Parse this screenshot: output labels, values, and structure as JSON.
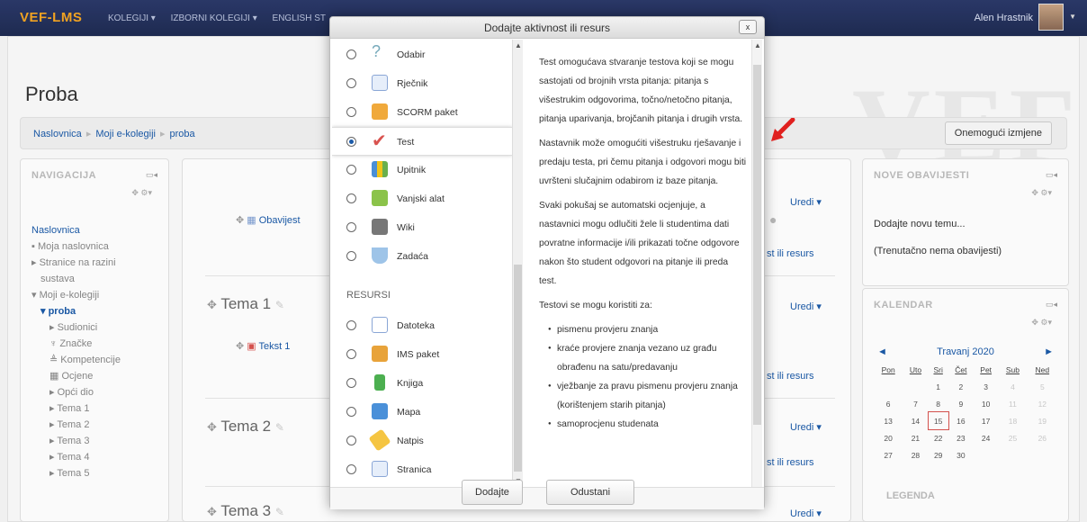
{
  "topbar": {
    "brand": "VEF-LMS",
    "menu": [
      "KOLEGIJI ▾",
      "IZBORNI KOLEGIJI ▾",
      "ENGLISH ST"
    ],
    "user_name": "Alen Hrastnik"
  },
  "page": {
    "title": "Proba",
    "breadcrumb": [
      "Naslovnica",
      "Moji e-kolegiji",
      "proba"
    ],
    "edit_button": "Onemogući izmjene"
  },
  "navigation": {
    "title": "NAVIGACIJA",
    "items": [
      "Naslovnica",
      "Moja naslovnica",
      "Stranice na razini",
      "sustava",
      "Moji e-kolegiji",
      "proba",
      "Sudionici",
      "Značke",
      "Kompetencije",
      "Ocjene",
      "Opći dio",
      "Tema 1",
      "Tema 2",
      "Tema 3",
      "Tema 4",
      "Tema 5"
    ]
  },
  "center": {
    "edit_label": "Uredi ▾",
    "add_label": "st ili resurs",
    "news_item": "Obavijest",
    "text_item": "Tekst 1",
    "topics": [
      "Tema 1",
      "Tema 2",
      "Tema 3"
    ]
  },
  "announcements": {
    "title": "NOVE OBAVIJESTI",
    "add_link": "Dodajte novu temu...",
    "empty": "(Trenutačno nema obavijesti)"
  },
  "calendar": {
    "title": "KALENDAR",
    "month": "Travanj 2020",
    "days": [
      "Pon",
      "Uto",
      "Sri",
      "Čet",
      "Pet",
      "Sub",
      "Ned"
    ],
    "weeks": [
      [
        "",
        "",
        "1",
        "2",
        "3",
        "4",
        "5"
      ],
      [
        "6",
        "7",
        "8",
        "9",
        "10",
        "11",
        "12"
      ],
      [
        "13",
        "14",
        "15",
        "16",
        "17",
        "18",
        "19"
      ],
      [
        "20",
        "21",
        "22",
        "23",
        "24",
        "25",
        "26"
      ],
      [
        "27",
        "28",
        "29",
        "30",
        "",
        "",
        ""
      ]
    ],
    "legend": "LEGENDA"
  },
  "modal": {
    "title": "Dodajte aktivnost ili resurs",
    "close": "x",
    "activities": [
      "Odabir",
      "Rječnik",
      "SCORM paket",
      "Test",
      "Upitnik",
      "Vanjski alat",
      "Wiki",
      "Zadaća"
    ],
    "resources_heading": "RESURSI",
    "resources": [
      "Datoteka",
      "IMS paket",
      "Knjiga",
      "Mapa",
      "Natpis",
      "Stranica"
    ],
    "selected": "Test",
    "description": {
      "p1": "Test omogućava stvaranje testova koji se mogu sastojati od brojnih vrsta pitanja: pitanja s višestrukim odgovorima, točno/netočno pitanja, pitanja uparivanja, brojčanih pitanja i drugih vrsta.",
      "p2": "Nastavnik može omogućiti višestruku rješavanje i predaju testa, pri čemu pitanja i odgovori mogu biti uvršteni slučajnim odabirom iz baze pitanja.",
      "p3": "Svaki pokušaj se automatski ocjenjuje, a nastavnici mogu odlučiti žele li studentima dati povratne informacije i/ili prikazati točne odgovore nakon što student odgovori na pitanje ili preda test.",
      "p4": "Testovi se mogu koristiti za:",
      "list": [
        "pismenu provjeru znanja",
        "kraće provjere znanja vezano uz građu obrađenu na satu/predavanju",
        "vježbanje za pravu pismenu provjeru znanja (korištenjem starih pitanja)",
        "samoprocjenu studenata"
      ]
    },
    "add_button": "Dodajte",
    "cancel_button": "Odustani"
  }
}
